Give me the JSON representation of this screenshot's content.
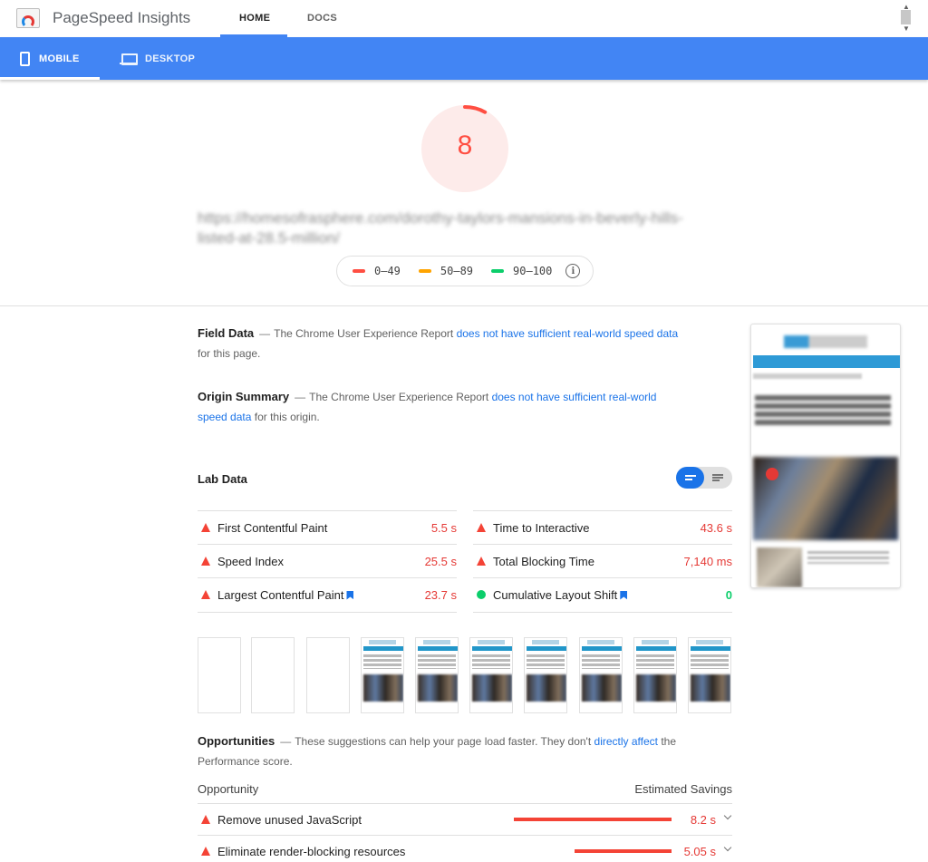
{
  "header": {
    "app_title": "PageSpeed Insights",
    "tabs": [
      {
        "label": "HOME"
      },
      {
        "label": "DOCS"
      }
    ]
  },
  "device_tabs": [
    {
      "label": "MOBILE"
    },
    {
      "label": "DESKTOP"
    }
  ],
  "score": {
    "value": "8",
    "gauge_fraction": 0.08,
    "color": "#ff4e42"
  },
  "url": "https://homesofrasphere.com/dorothy-taylors-mansions-in-beverly-hills-listed-at-28.5-million/",
  "legend": [
    {
      "range": "0–49",
      "color": "#ff4e42"
    },
    {
      "range": "50–89",
      "color": "#ffa400"
    },
    {
      "range": "90–100",
      "color": "#0cce6b"
    }
  ],
  "field_data": {
    "title": "Field Data",
    "pre": "The Chrome User Experience Report",
    "link": "does not have sufficient real-world speed data",
    "post": "for this page."
  },
  "origin_summary": {
    "title": "Origin Summary",
    "pre": "The Chrome User Experience Report",
    "link": "does not have sufficient real-world speed data",
    "post": "for this origin."
  },
  "lab_data": {
    "title": "Lab Data",
    "metrics_left": [
      {
        "label": "First Contentful Paint",
        "value": "5.5 s",
        "status": "fail"
      },
      {
        "label": "Speed Index",
        "value": "25.5 s",
        "status": "fail"
      },
      {
        "label": "Largest Contentful Paint",
        "value": "23.7 s",
        "status": "fail"
      }
    ],
    "metrics_right": [
      {
        "label": "Time to Interactive",
        "value": "43.6 s",
        "status": "fail"
      },
      {
        "label": "Total Blocking Time",
        "value": "7,140 ms",
        "status": "fail"
      },
      {
        "label": "Cumulative Layout Shift",
        "value": "0",
        "status": "pass"
      }
    ]
  },
  "opportunities": {
    "title": "Opportunities",
    "pre": "These suggestions can help your page load faster. They don't",
    "link": "directly affect",
    "post": "the Performance score.",
    "col_opportunity": "Opportunity",
    "col_savings": "Estimated Savings",
    "items": [
      {
        "label": "Remove unused JavaScript",
        "value": "8.2 s"
      },
      {
        "label": "Eliminate render-blocking resources",
        "value": "5.05 s"
      }
    ]
  },
  "colors": {
    "accent": "#4285f4",
    "fail": "#f44336",
    "pass": "#0cce6b",
    "link": "#1a73e8"
  }
}
